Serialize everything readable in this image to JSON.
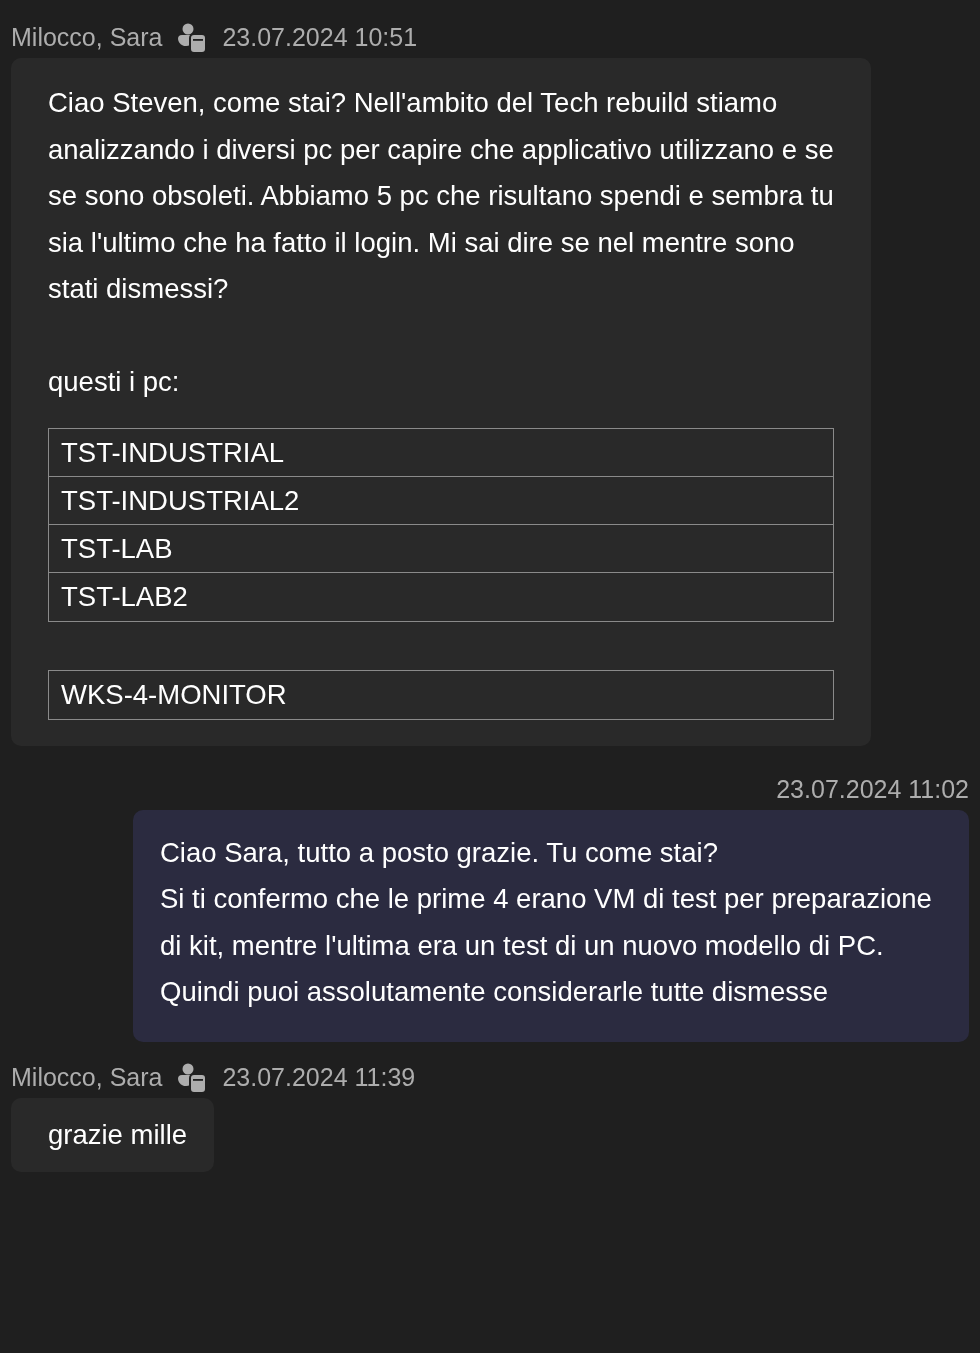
{
  "messages": [
    {
      "kind": "incoming",
      "sender": "Milocco, Sara",
      "time": "23.07.2024 10:51",
      "blocks": [
        {
          "kind": "text",
          "text": "Ciao Steven, come stai? Nell'ambito del Tech rebuild stiamo analizzando i diversi pc per capire che applicativo utilizzano e se se sono obsoleti. Abbiamo 5 pc che risultano spendi e sembra tu sia l'ultimo che ha fatto il login. Mi sai dire se nel mentre sono stati dismessi?"
        },
        {
          "kind": "text",
          "text": "questi i pc:"
        },
        {
          "kind": "table",
          "rows": [
            "TST-INDUSTRIAL",
            "TST-INDUSTRIAL2",
            "TST-LAB",
            "TST-LAB2"
          ]
        },
        {
          "kind": "table",
          "rows": [
            "WKS-4-MONITOR"
          ]
        }
      ]
    },
    {
      "kind": "outgoing",
      "time": "23.07.2024 11:02",
      "blocks": [
        {
          "kind": "text",
          "text": "Ciao Sara, tutto a posto grazie. Tu come stai?\nSi ti confermo che le prime 4 erano VM di test per preparazione di kit, mentre l'ultima era un test di un nuovo modello di PC. Quindi puoi assolutamente considerarle tutte dismesse"
        }
      ]
    },
    {
      "kind": "incoming",
      "sender": "Milocco, Sara",
      "time": "23.07.2024 11:39",
      "blocks": [
        {
          "kind": "text",
          "text": "grazie mille"
        }
      ]
    }
  ]
}
